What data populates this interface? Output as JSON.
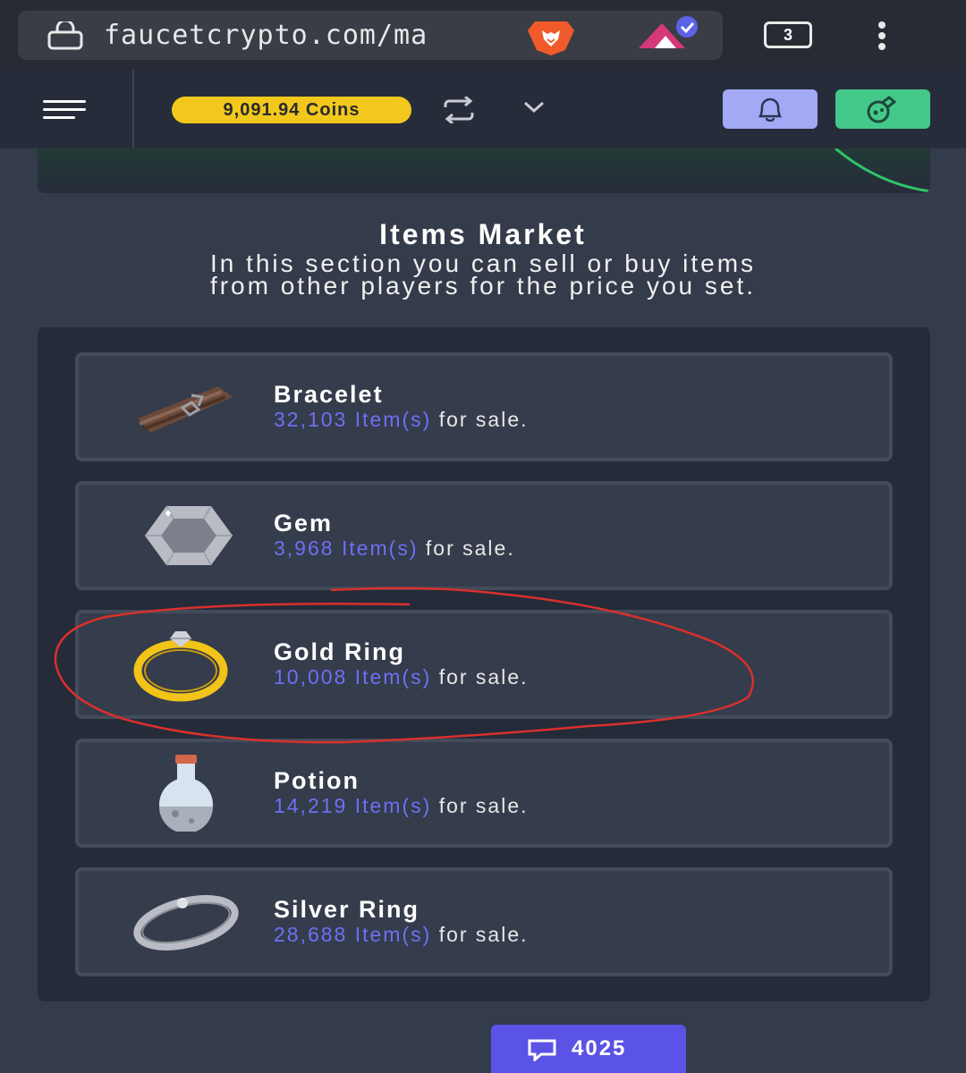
{
  "browser": {
    "url": "faucetcrypto.com/ma",
    "tab_count": "3",
    "icons": [
      "lock-icon",
      "brave-lion-icon",
      "brave-rewards-icon",
      "tabs-icon",
      "menu-dots-icon"
    ]
  },
  "header": {
    "coins": "9,091.94 Coins",
    "icons": [
      "hamburger-icon",
      "swap-icon",
      "chevron-down-icon",
      "bell-icon",
      "potion-icon"
    ],
    "colors": {
      "coins_bg": "#f2c81d",
      "bell_bg": "#a3a9f4",
      "potion_bg": "#44c98b"
    }
  },
  "market": {
    "title": "Items Market",
    "subtitle_line1": "In this section you can sell or buy items",
    "subtitle_line2": "from other players for the price you set."
  },
  "items": [
    {
      "name": "Bracelet",
      "count": "32,103 Item(s)",
      "suffix": "for sale.",
      "icon": "bracelet-icon"
    },
    {
      "name": "Gem",
      "count": "3,968 Item(s)",
      "suffix": "for sale.",
      "icon": "gem-icon"
    },
    {
      "name": "Gold Ring",
      "count": "10,008 Item(s)",
      "suffix": "for sale.",
      "icon": "gold-ring-icon"
    },
    {
      "name": "Potion",
      "count": "14,219 Item(s)",
      "suffix": "for sale.",
      "icon": "potion-flask-icon"
    },
    {
      "name": "Silver Ring",
      "count": "28,688 Item(s)",
      "suffix": "for sale.",
      "icon": "silver-ring-icon"
    }
  ],
  "chat": {
    "count": "4025",
    "icon": "chat-icon"
  },
  "colors": {
    "accent": "#6f6ff5",
    "chat_bg": "#5b53e6",
    "annotation": "#d9302c"
  }
}
